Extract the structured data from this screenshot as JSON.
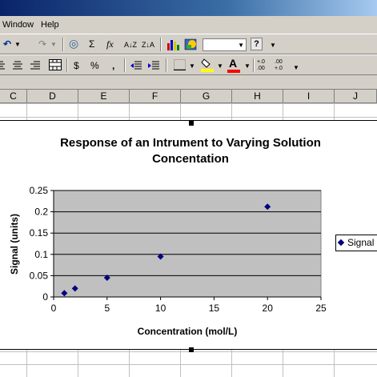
{
  "menu": {
    "window_label": "Window",
    "help_label": "Help"
  },
  "toolbar": {
    "sum_symbol": "Σ",
    "function_symbol": "fx",
    "sort_asc_label": "A↓Z",
    "sort_desc_label": "Z↓A",
    "help_symbol": "?",
    "currency_symbol": "$",
    "percent_symbol": "%",
    "comma_symbol": ",",
    "inc_decimal_label": "+.0 .00",
    "dec_decimal_label": ".00 +.0",
    "font_color_symbol": "A",
    "zoom_value": ""
  },
  "columns": [
    "C",
    "D",
    "E",
    "F",
    "G",
    "H",
    "I",
    "J"
  ],
  "chart_data": {
    "type": "scatter",
    "title": "Response of an Intrument to Varying Solution Concentation",
    "title_lines": [
      "Response of an Intrument to Varying Solution",
      "Concentation"
    ],
    "xlabel": "Concentration (mol/L)",
    "ylabel": "Signal (units)",
    "xlim": [
      0,
      25
    ],
    "ylim": [
      0,
      0.25
    ],
    "x_ticks": [
      "0",
      "5",
      "10",
      "15",
      "20",
      "25"
    ],
    "y_ticks": [
      "0",
      "0.05",
      "0.1",
      "0.15",
      "0.2",
      "0.25"
    ],
    "grid": true,
    "legend_position": "right",
    "plot_background": "#c0c0c0",
    "marker_color": "#000080",
    "series": [
      {
        "name": "Signal",
        "points": [
          {
            "x": 1,
            "y": 0.009
          },
          {
            "x": 2,
            "y": 0.02
          },
          {
            "x": 5,
            "y": 0.045
          },
          {
            "x": 10,
            "y": 0.095
          },
          {
            "x": 20,
            "y": 0.212
          }
        ]
      }
    ]
  }
}
